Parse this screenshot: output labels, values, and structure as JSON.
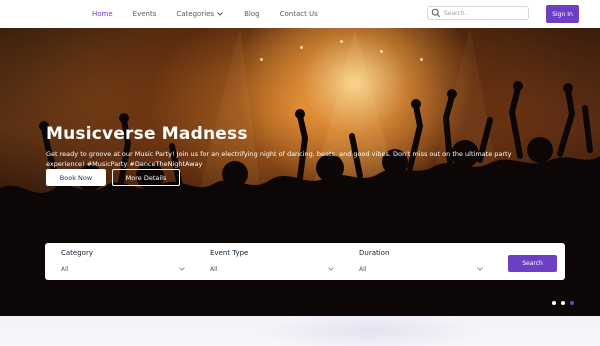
{
  "nav": {
    "links": [
      {
        "label": "Home",
        "active": true
      },
      {
        "label": "Events",
        "active": false
      },
      {
        "label": "Categories",
        "active": false,
        "has_dropdown": true
      },
      {
        "label": "Blog",
        "active": false
      },
      {
        "label": "Contact Us",
        "active": false
      }
    ],
    "search_placeholder": "Search..",
    "signin_label": "Sign In"
  },
  "hero": {
    "title": "Musicverse Madness",
    "description": "Get ready to groove at our Music Party! Join us for an electrifying night of dancing, beats, and good vibes. Don't miss out on the ultimate party experience! #MusicParty #DanceTheNightAway",
    "book_label": "Book Now",
    "more_label": "More Details"
  },
  "filter": {
    "fields": [
      {
        "label": "Category",
        "value": "All"
      },
      {
        "label": "Event Type",
        "value": "All"
      },
      {
        "label": "Duration",
        "value": "All"
      }
    ],
    "search_label": "Search"
  },
  "carousel": {
    "slides": 3,
    "active_index": 2
  },
  "colors": {
    "accent": "#6c3fc5",
    "nav_bg": "#ffffff",
    "text_muted": "#5a5a66"
  },
  "icons": {
    "search": "search-icon",
    "dropdown": "chevron-down-icon"
  }
}
